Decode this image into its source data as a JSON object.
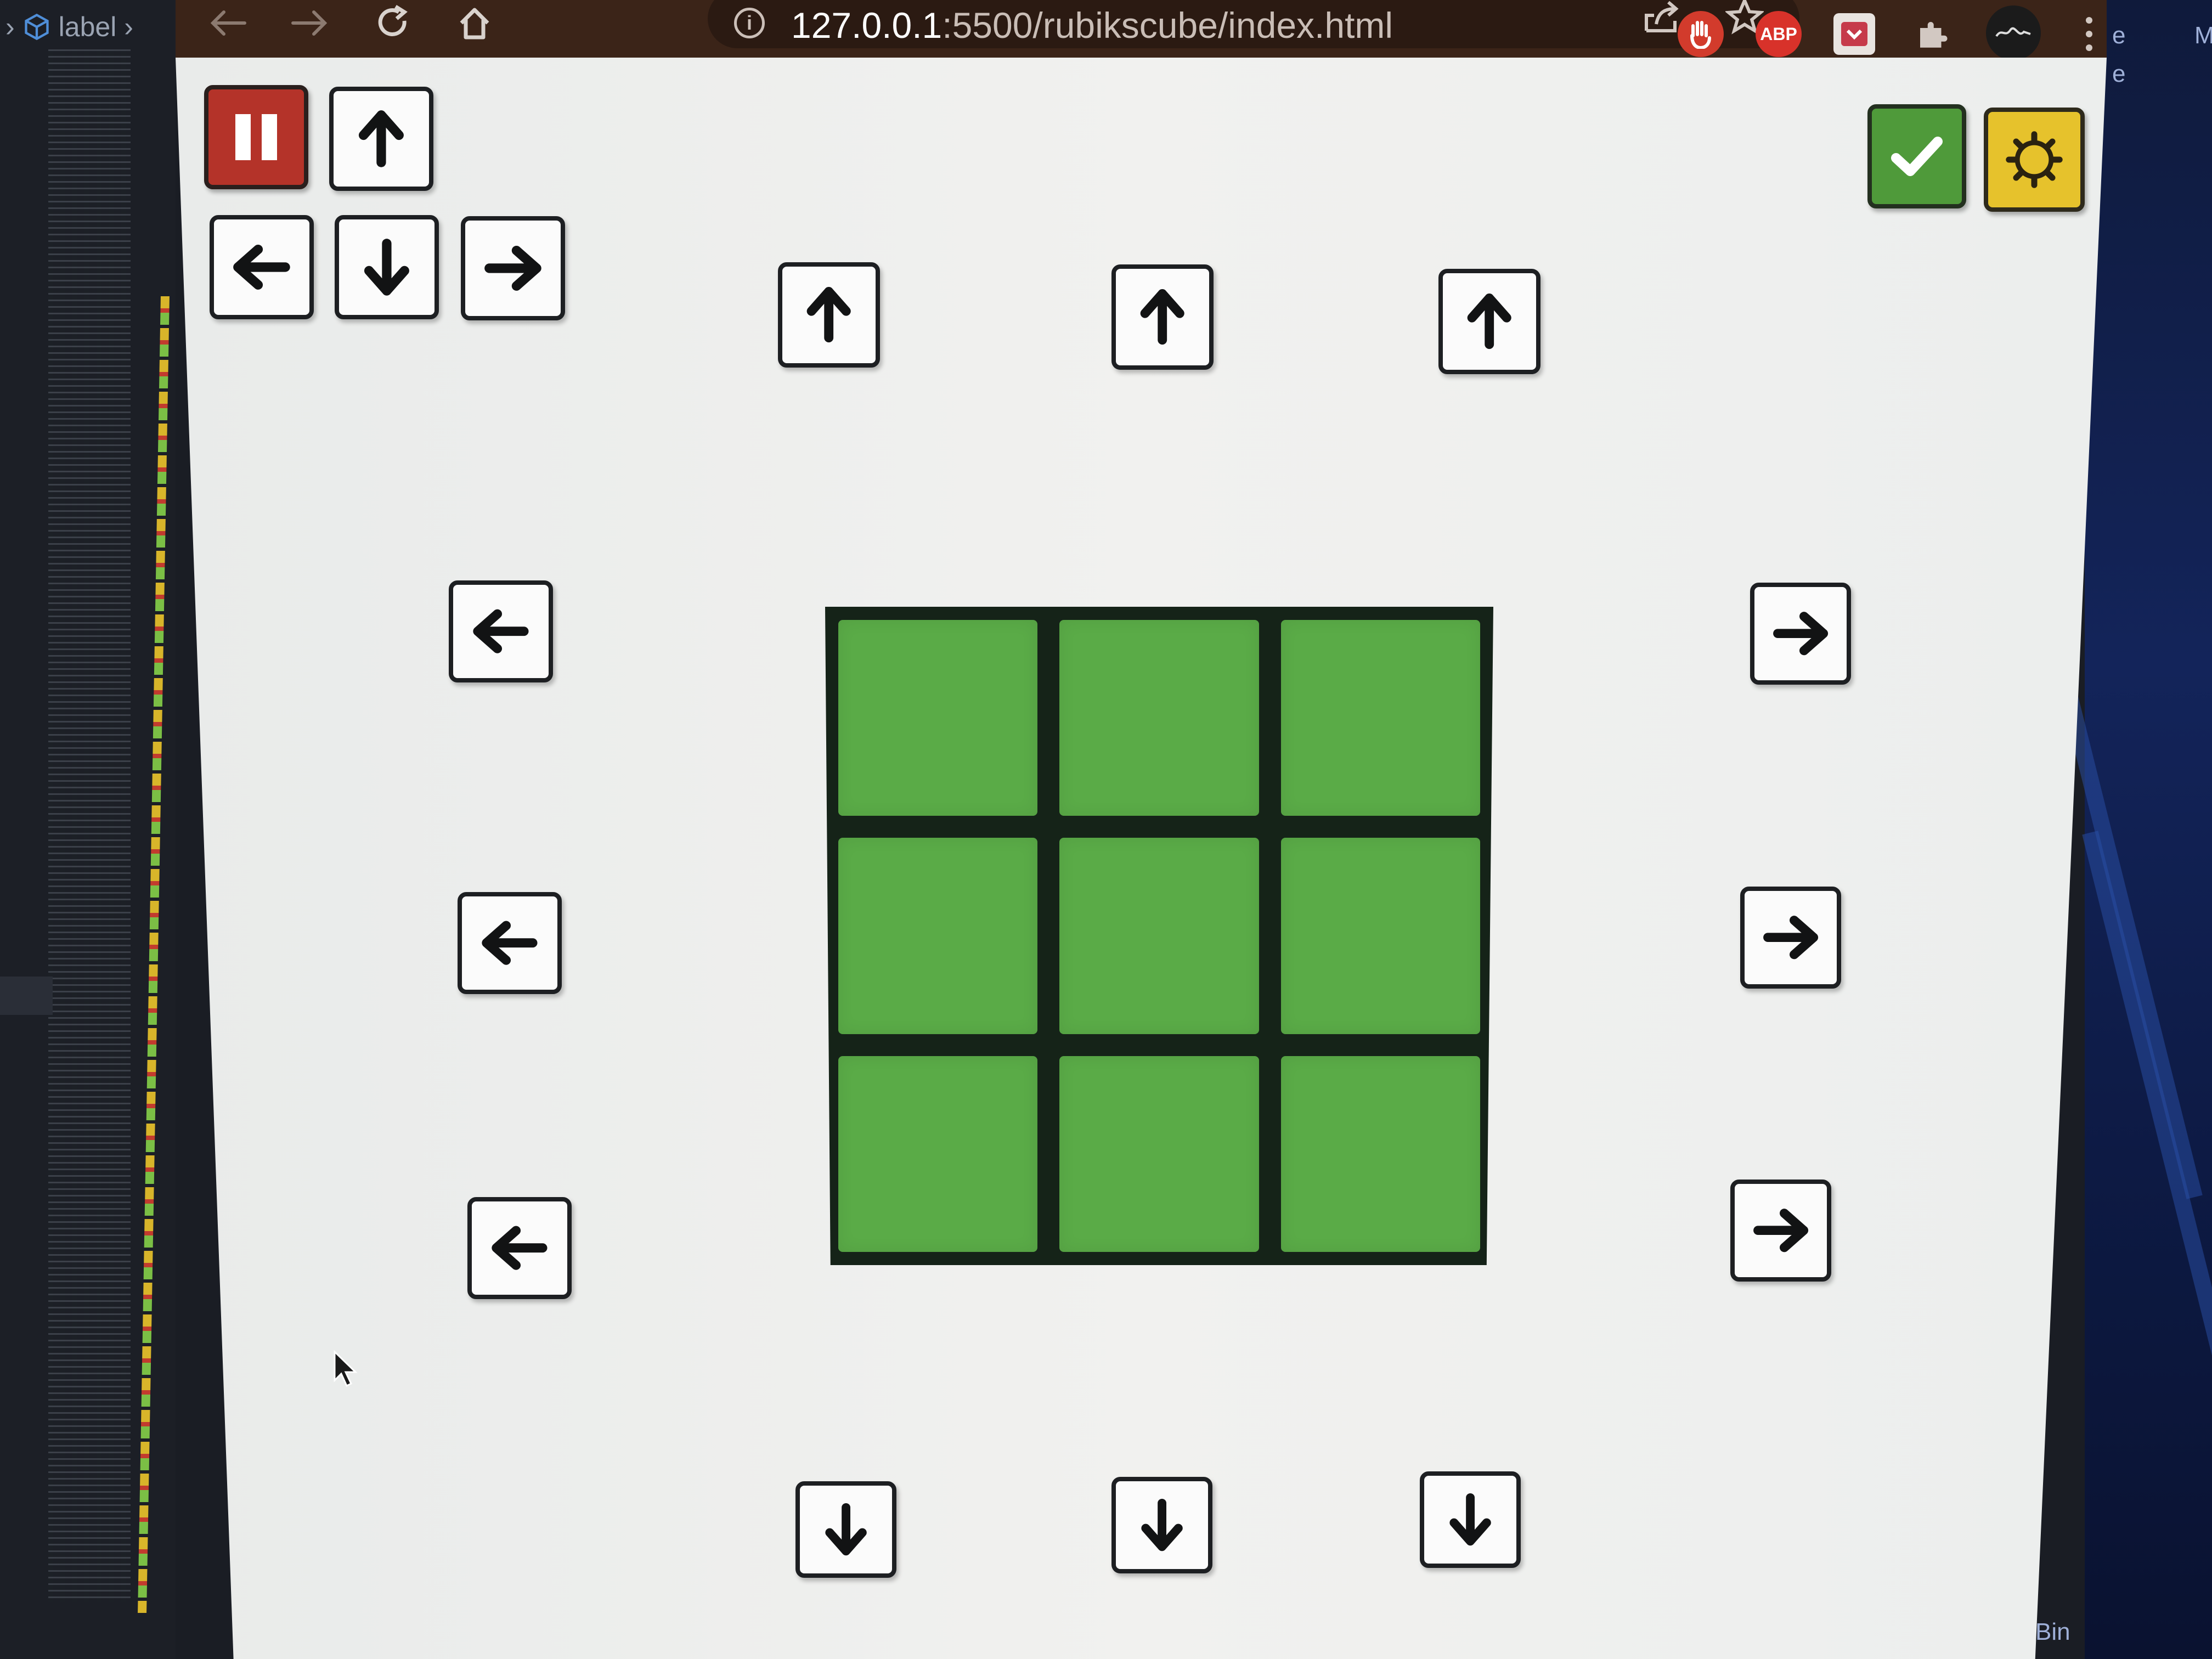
{
  "editor": {
    "breadcrumb_label": "label"
  },
  "browser": {
    "url_host": "127.0.0.1",
    "url_path": ":5500/rubikscube/index.html",
    "extensions": [
      {
        "name": "hand-extension",
        "color": "#d23b2c"
      },
      {
        "name": "adblock-plus",
        "label": "ABP",
        "color": "#d8322a"
      },
      {
        "name": "pocket-extension",
        "color": "#e9e4e0"
      },
      {
        "name": "extensions-puzzle",
        "color": "#d2c8c2"
      },
      {
        "name": "profile-avatar",
        "color": "#1b1b1b"
      }
    ]
  },
  "controls": {
    "pause_color": "#b43329",
    "check_color": "#4f9a3a",
    "settings_color": "#e6c22c"
  },
  "cube_face": {
    "color": "#5aab47",
    "stickers": [
      "green",
      "green",
      "green",
      "green",
      "green",
      "green",
      "green",
      "green",
      "green"
    ]
  },
  "desktop": {
    "letters_top": "e",
    "letters_top_right": "M",
    "letter_mid": "e",
    "bottom_text": "Bin"
  }
}
